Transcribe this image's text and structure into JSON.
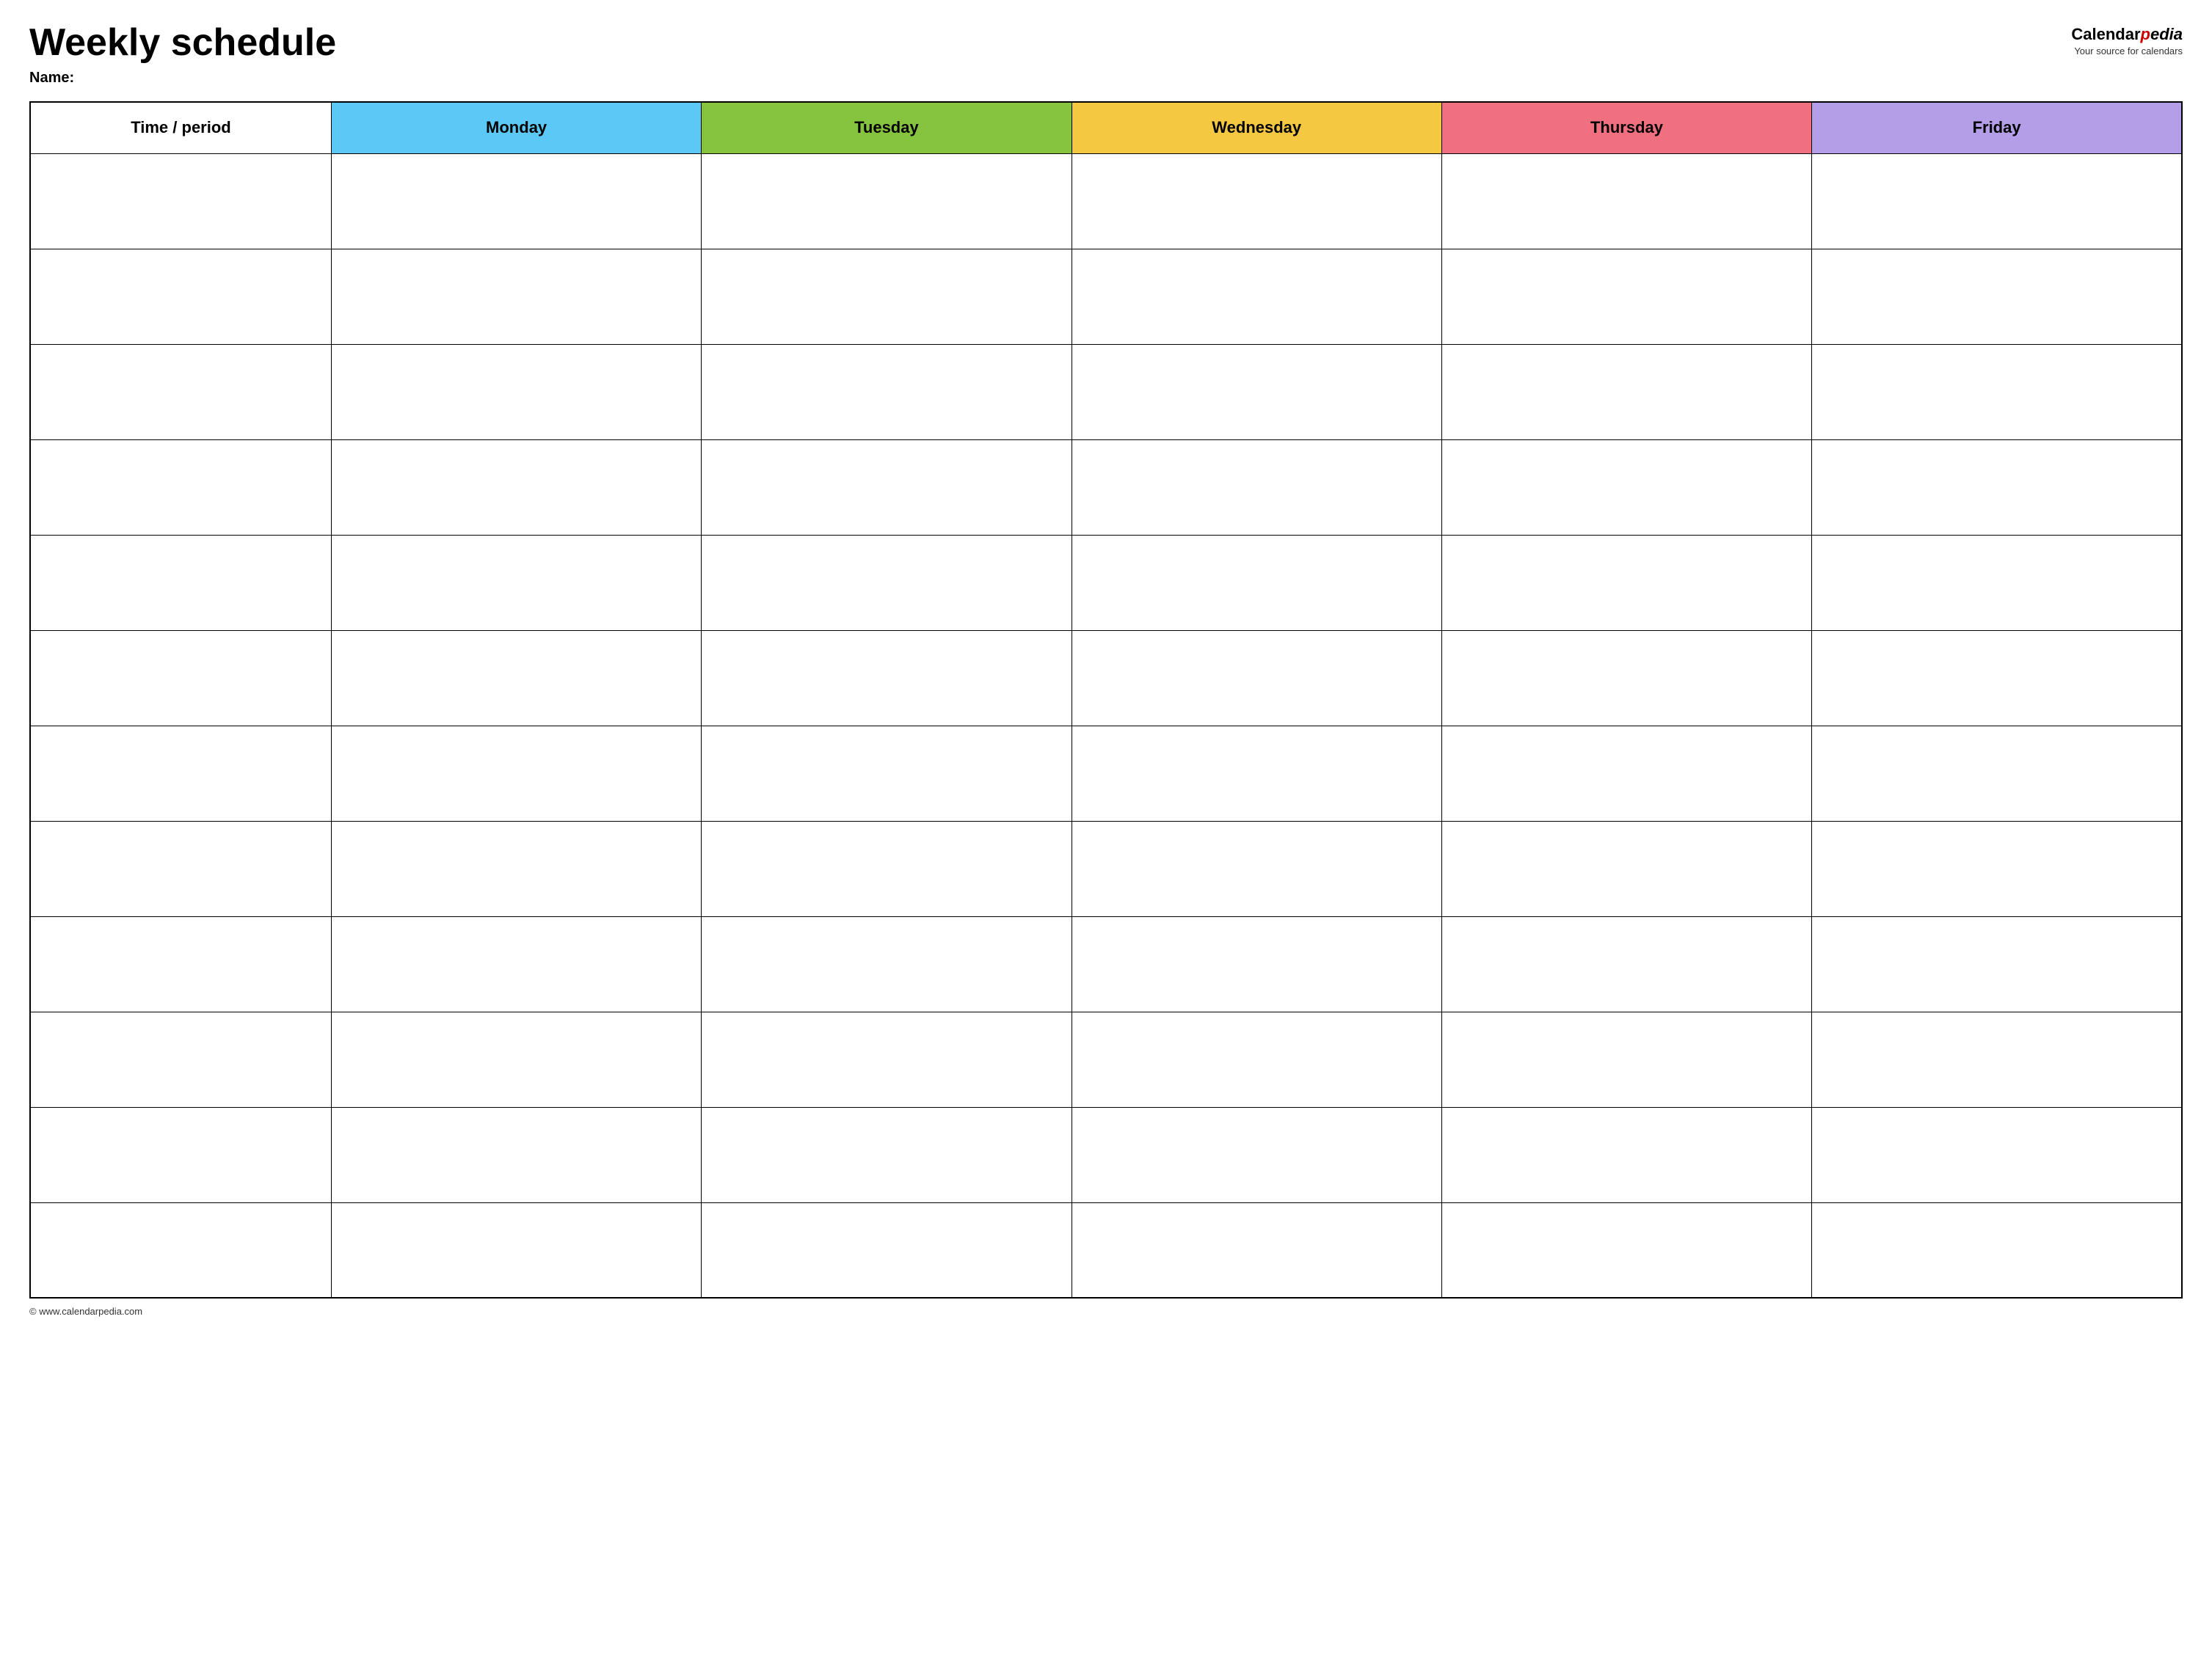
{
  "header": {
    "title": "Weekly schedule",
    "name_label": "Name:",
    "logo": {
      "text_calendar": "Calendar",
      "text_pedia": "pedia",
      "tagline": "Your source for calendars"
    }
  },
  "table": {
    "headers": [
      {
        "id": "time",
        "label": "Time / period",
        "color": "#ffffff"
      },
      {
        "id": "monday",
        "label": "Monday",
        "color": "#5bc8f5"
      },
      {
        "id": "tuesday",
        "label": "Tuesday",
        "color": "#86c440"
      },
      {
        "id": "wednesday",
        "label": "Wednesday",
        "color": "#f5c842"
      },
      {
        "id": "thursday",
        "label": "Thursday",
        "color": "#f07080"
      },
      {
        "id": "friday",
        "label": "Friday",
        "color": "#b49ee8"
      }
    ],
    "row_count": 12
  },
  "footer": {
    "copyright": "© www.calendarpedia.com"
  }
}
